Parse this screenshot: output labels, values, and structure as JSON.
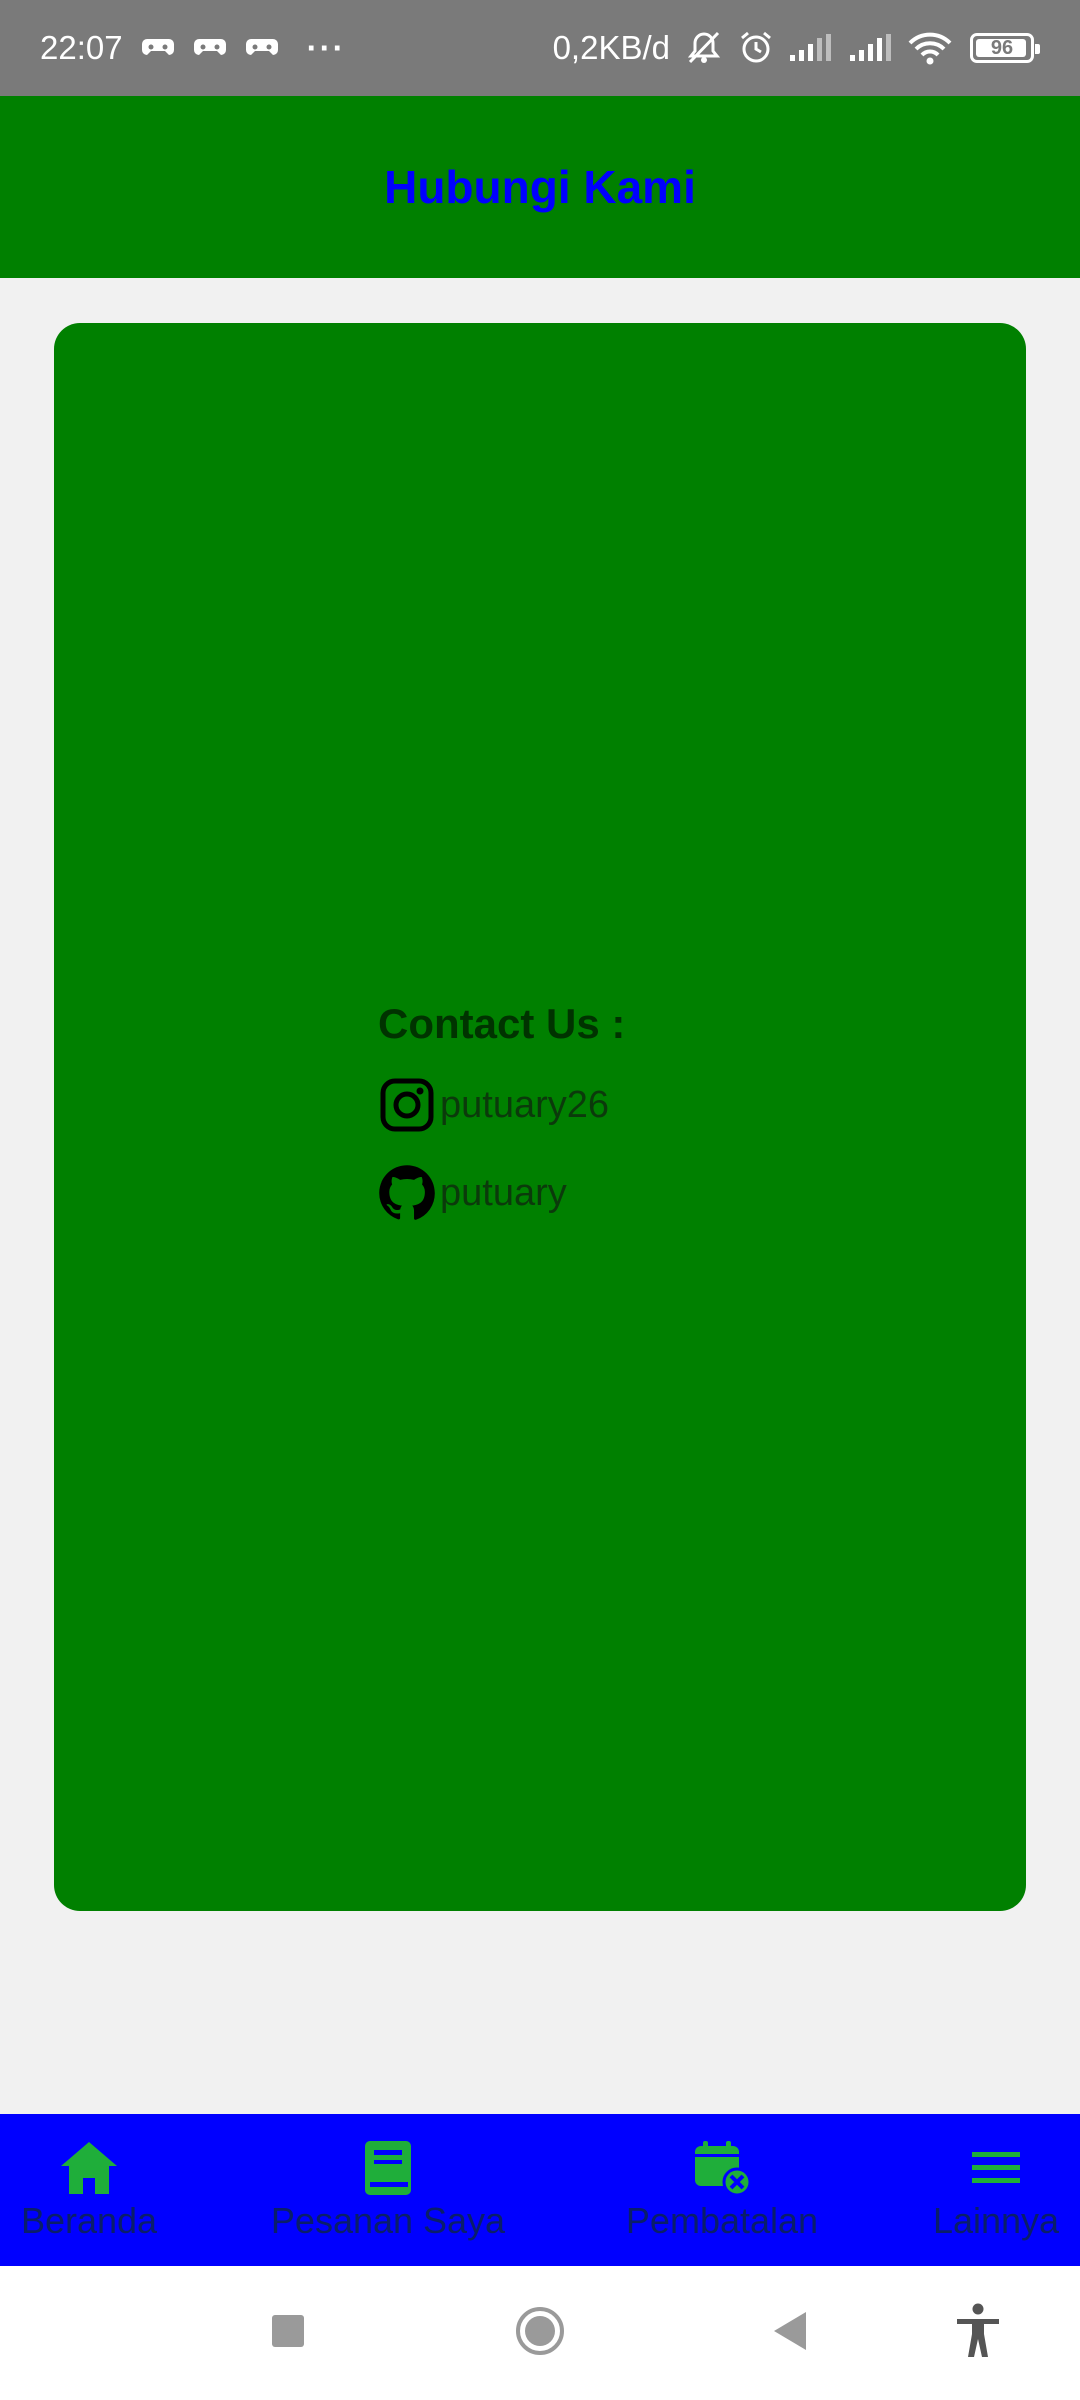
{
  "status_bar": {
    "time": "22:07",
    "overflow": "···",
    "net_speed": "0,2KB/d",
    "battery": "96"
  },
  "app_bar": {
    "title": "Hubungi Kami"
  },
  "contact": {
    "heading": "Contact Us :",
    "instagram": "putuary26",
    "github": "putuary"
  },
  "bottom_nav": {
    "items": [
      {
        "label": "Beranda",
        "icon": "home-icon"
      },
      {
        "label": "Pesanan Saya",
        "icon": "book-icon"
      },
      {
        "label": "Pembatalan",
        "icon": "calendar-cancel-icon"
      },
      {
        "label": "Lainnya",
        "icon": "menu-icon"
      }
    ]
  },
  "colors": {
    "app_bar_bg": "#008000",
    "title_color": "#0000ff",
    "card_bg": "#008000",
    "bottom_nav_bg": "#0000ff",
    "nav_icon": "#1fae3a",
    "status_bar_bg": "#7a7a7a",
    "page_bg": "#f1f1f1"
  }
}
